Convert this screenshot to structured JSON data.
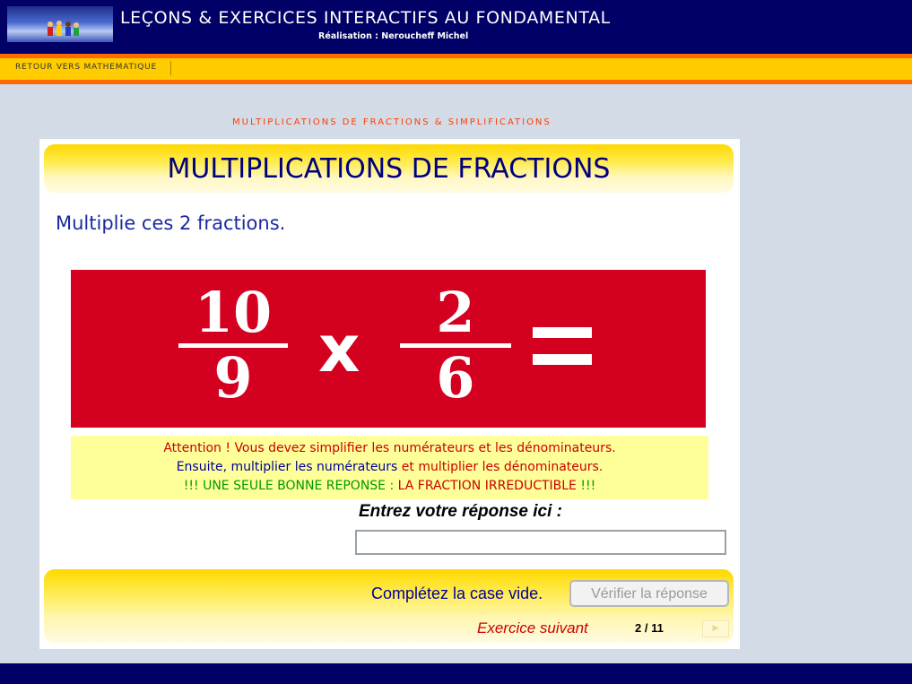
{
  "header": {
    "title": "LEÇONS & EXERCICES INTERACTIFS AU FONDAMENTAL",
    "author": "Réalisation : Neroucheff Michel"
  },
  "nav": {
    "back_link": "RETOUR VERS MATHEMATIQUE"
  },
  "breadcrumb": "MULTIPLICATIONS DE FRACTIONS & SIMPLIFICATIONS",
  "exercise": {
    "title": "MULTIPLICATIONS DE FRACTIONS",
    "instruction": "Multiplie ces 2 fractions.",
    "fraction1": {
      "numerator": "10",
      "denominator": "9"
    },
    "operator": "x",
    "fraction2": {
      "numerator": "2",
      "denominator": "6"
    },
    "equals": "="
  },
  "warning": {
    "line1": "Attention ! Vous devez simplifier les numérateurs et les dénominateurs.",
    "line2_part1": "Ensuite, multiplier les numérateurs",
    "line2_part2": " et multiplier les dénominateurs.",
    "line3_part1": "!!! UNE SEULE BONNE REPONSE : ",
    "line3_part2": "LA FRACTION IRREDUCTIBLE",
    "line3_part3": " !!!"
  },
  "answer": {
    "label": "Entrez votre réponse ici :",
    "value": "",
    "placeholder": ""
  },
  "bottom": {
    "feedback": "Complétez la case vide.",
    "verify_label": "Vérifier la réponse",
    "next_label": "Exercice suivant",
    "counter": "2 / 11",
    "next_arrow": "▶"
  },
  "colors": {
    "header_bg": "#000066",
    "nav_bg": "#ffcc00",
    "nav_border": "#ff6a00",
    "page_bg": "#d3dce6",
    "problem_bg": "#d40020",
    "warning_bg": "#ffff99",
    "title_text": "#000080"
  }
}
